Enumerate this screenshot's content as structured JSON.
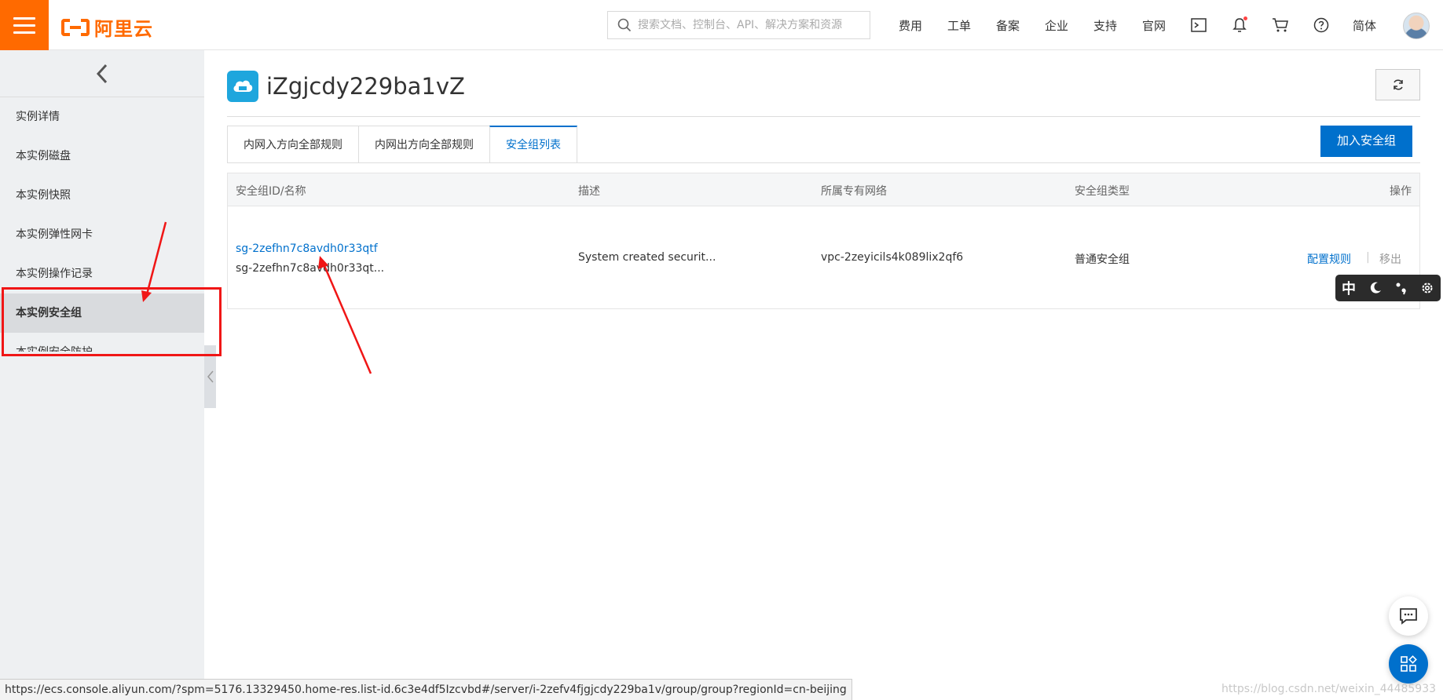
{
  "topbar": {
    "logo_text": "阿里云",
    "search_placeholder": "搜索文档、控制台、API、解决方案和资源",
    "links": [
      "费用",
      "工单",
      "备案",
      "企业",
      "支持",
      "官网"
    ],
    "lang": "简体"
  },
  "sidebar": {
    "items": [
      "实例详情",
      "本实例磁盘",
      "本实例快照",
      "本实例弹性网卡",
      "本实例操作记录",
      "本实例安全组",
      "本实例安全防护"
    ]
  },
  "instance": {
    "title": "iZgjcdy229ba1vZ"
  },
  "tabs": [
    "内网入方向全部规则",
    "内网出方向全部规则",
    "安全组列表"
  ],
  "add_button": "加入安全组",
  "table": {
    "headers": [
      "安全组ID/名称",
      "描述",
      "所属专有网络",
      "安全组类型",
      "操作"
    ],
    "row": {
      "sg_id": "sg-2zefhn7c8avdh0r33qtf",
      "sg_name": "sg-2zefhn7c8avdh0r33qt...",
      "description": "System created securit...",
      "vpc": "vpc-2zeyicils4k089lix2qf6",
      "type": "普通安全组",
      "action_config": "配置规则",
      "action_sep": "|",
      "action_remove": "移出"
    }
  },
  "ime": {
    "label": "中"
  },
  "status_url": "https://ecs.console.aliyun.com/?spm=5176.13329450.home-res.list-id.6c3e4df5Izcvbd#/server/i-2zefv4fjgjcdy229ba1v/group/group?regionId=cn-beijing",
  "watermark": "https://blog.csdn.net/weixin_44485933",
  "colors": {
    "brand": "#ff6a00",
    "primary": "#0070cc",
    "annotation": "#f01616"
  }
}
